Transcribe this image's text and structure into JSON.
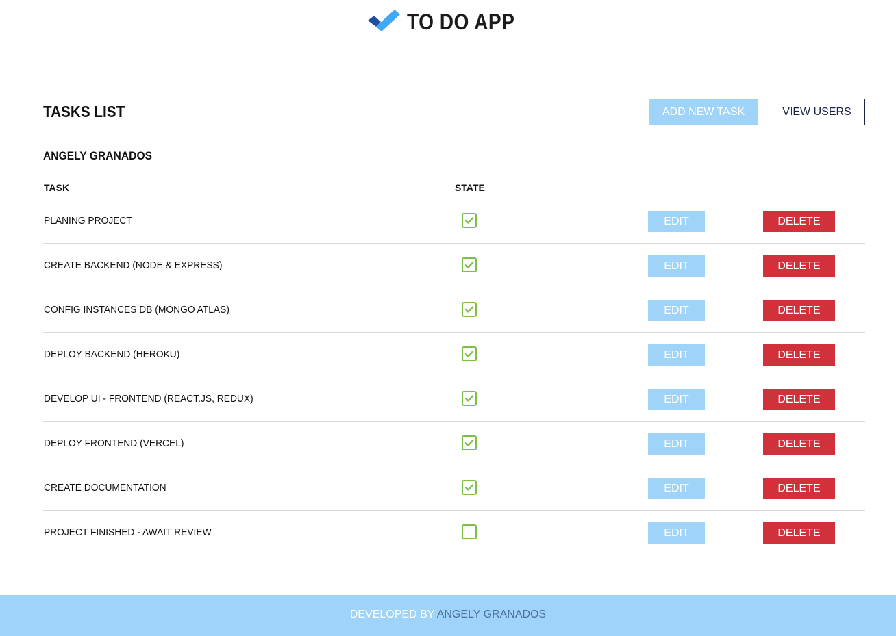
{
  "app": {
    "title": "TO DO APP",
    "logo_icon": "double-check-logo-icon",
    "colors": {
      "dark_blue": "#1e4fa3",
      "light_blue": "#3fa9f5"
    }
  },
  "tasks_panel": {
    "title": "TASKS LIST",
    "add_button_label": "ADD NEW TASK",
    "view_users_label": "VIEW USERS",
    "user_name": "ANGELY GRANADOS"
  },
  "table": {
    "headers": {
      "task": "TASK",
      "state": "STATE"
    },
    "edit_label": "EDIT",
    "delete_label": "DELETE",
    "colors": {
      "edit": "#9fd3f7",
      "delete": "#d0313a",
      "check": "#7cc04a"
    },
    "rows": [
      {
        "task": "PLANING PROJECT",
        "done": true
      },
      {
        "task": "CREATE BACKEND (NODE & EXPRESS)",
        "done": true
      },
      {
        "task": "CONFIG INSTANCES DB (MONGO ATLAS)",
        "done": true
      },
      {
        "task": "DEPLOY BACKEND (HEROKU)",
        "done": true
      },
      {
        "task": "DEVELOP UI - FRONTEND (REACT.JS, REDUX)",
        "done": true
      },
      {
        "task": "DEPLOY FRONTEND (VERCEL)",
        "done": true
      },
      {
        "task": "CREATE DOCUMENTATION",
        "done": true
      },
      {
        "task": "PROJECT FINISHED - AWAIT REVIEW",
        "done": false
      }
    ]
  },
  "footer": {
    "prefix": "DEVELOPED BY",
    "author": "ANGELY GRANADOS"
  }
}
